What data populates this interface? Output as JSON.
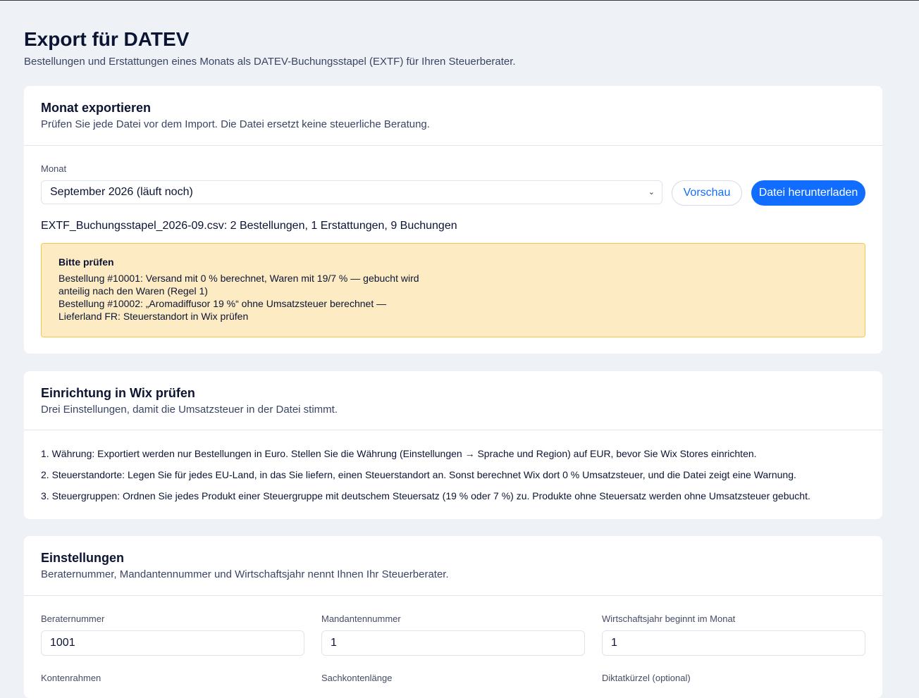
{
  "header": {
    "title": "Export für DATEV",
    "subtitle": "Bestellungen und Erstattungen eines Monats als DATEV-Buchungsstapel (EXTF) für Ihren Steuerberater."
  },
  "export": {
    "title": "Monat exportieren",
    "subtitle": "Prüfen Sie jede Datei vor dem Import. Die Datei ersetzt keine steuerliche Beratung.",
    "month_label": "Monat",
    "month_value": "September 2026 (läuft noch)",
    "preview_label": "Vorschau",
    "download_label": "Datei herunterladen",
    "summary": "EXTF_Buchungsstapel_2026-09.csv: 2 Bestellungen, 1 Erstattungen, 9 Buchungen",
    "warning": {
      "title": "Bitte prüfen",
      "lines": [
        "Bestellung #10001: Versand mit 0 % berechnet, Waren mit 19/7 % — gebucht wird",
        "anteilig nach den Waren (Regel 1)",
        "Bestellung #10002: „Aromadiffusor 19 %“ ohne Umsatzsteuer berechnet —",
        "Lieferland FR: Steuerstandort in Wix prüfen"
      ]
    }
  },
  "setup": {
    "title": "Einrichtung in Wix prüfen",
    "subtitle": "Drei Einstellungen, damit die Umsatzsteuer in der Datei stimmt.",
    "steps": [
      "1. Währung: Exportiert werden nur Bestellungen in Euro. Stellen Sie die Währung (Einstellungen → Sprache und Region) auf EUR, bevor Sie Wix Stores einrichten.",
      "2. Steuerstandorte: Legen Sie für jedes EU-Land, in das Sie liefern, einen Steuerstandort an. Sonst berechnet Wix dort 0 % Umsatzsteuer, und die Datei zeigt eine Warnung.",
      "3. Steuergruppen: Ordnen Sie jedes Produkt einer Steuergruppe mit deutschem Steuersatz (19 % oder 7 %) zu. Produkte ohne Steuersatz werden ohne Umsatzsteuer gebucht."
    ]
  },
  "settings": {
    "title": "Einstellungen",
    "subtitle": "Beraternummer, Mandantennummer und Wirtschaftsjahr nennt Ihnen Ihr Steuerberater.",
    "beraternummer_label": "Beraternummer",
    "beraternummer_value": "1001",
    "mandantennummer_label": "Mandantennummer",
    "mandantennummer_value": "1",
    "wj_label": "Wirtschaftsjahr beginnt im Monat",
    "wj_value": "1",
    "kontenrahmen_label": "Kontenrahmen",
    "sachkontenlaenge_label": "Sachkontenlänge",
    "diktat_label": "Diktatkürzel (optional)"
  }
}
